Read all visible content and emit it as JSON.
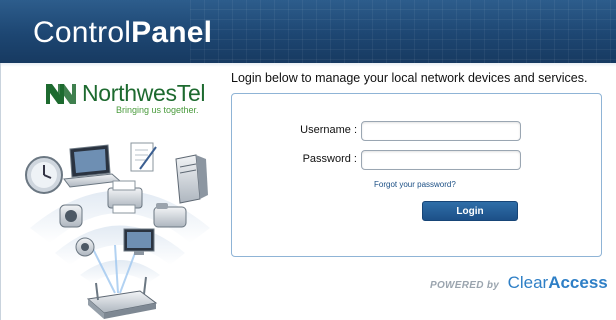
{
  "header": {
    "title_regular": "Control",
    "title_bold": "Panel"
  },
  "logo": {
    "name": "NorthwesTel",
    "tagline": "Bringing us together."
  },
  "login": {
    "intro": "Login below to manage your local network devices and services.",
    "username_label": "Username :",
    "password_label": "Password :",
    "username_value": "",
    "password_value": "",
    "forgot_link": "Forgot your password?",
    "login_button": "Login"
  },
  "footer": {
    "powered_by": "POWERED by",
    "brand_regular": "Clear",
    "brand_bold": "Access"
  },
  "colors": {
    "header_bg": "#1d4672",
    "logo_green": "#1d6a2f",
    "accent_blue": "#2e7fc6",
    "button_blue": "#1d5088"
  },
  "icons": [
    "northwestel-logo-icon",
    "clock-icon",
    "laptop-icon",
    "document-icon",
    "server-icon",
    "printer-icon",
    "phone-icon",
    "camera-icon",
    "monitor-icon",
    "router-icon"
  ]
}
